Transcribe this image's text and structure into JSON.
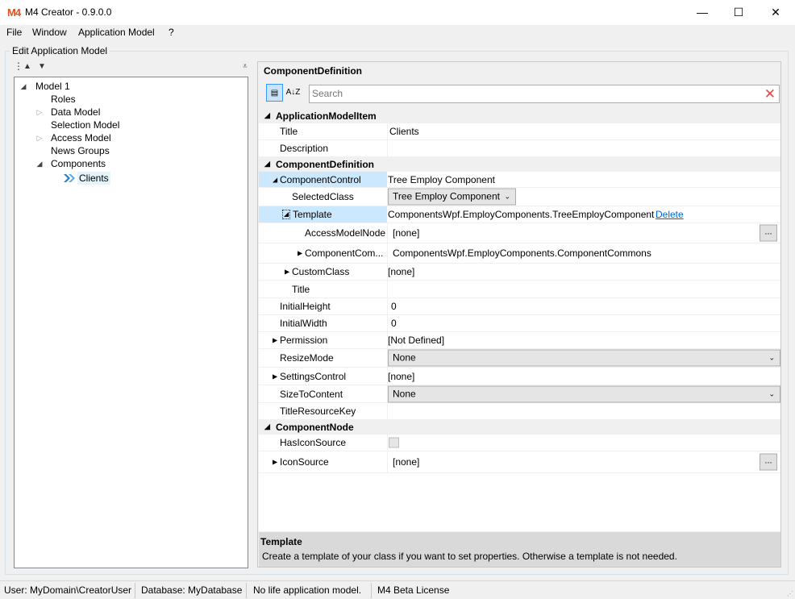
{
  "app": {
    "logo": "M4",
    "title": "M4 Creator - 0.9.0.0"
  },
  "window_controls": {
    "minimize": "—",
    "maximize": "☐",
    "close": "✕"
  },
  "menu": [
    "File",
    "Window",
    "Application Model",
    "?"
  ],
  "group": {
    "label": "Edit Application Model"
  },
  "tree_toolbar": {
    "grip": "⋮",
    "up": "▲",
    "down": "▼",
    "overflow": "⩡"
  },
  "tree": {
    "nodes": [
      {
        "label": "Model 1",
        "arrow": "◢"
      },
      {
        "label": "Roles",
        "arrow": ""
      },
      {
        "label": "Data Model",
        "arrow": "▷"
      },
      {
        "label": "Selection Model",
        "arrow": ""
      },
      {
        "label": "Access Model",
        "arrow": "▷"
      },
      {
        "label": "News Groups",
        "arrow": ""
      },
      {
        "label": "Components",
        "arrow": "◢"
      },
      {
        "label": "Clients",
        "arrow": ""
      }
    ]
  },
  "property_grid": {
    "header": "ComponentDefinition",
    "categorized_icon": "▤",
    "alphabetical_icon": "A↓Z",
    "search_placeholder": "Search",
    "clear_icon": "✕",
    "categories": [
      "ApplicationModelItem",
      "ComponentDefinition",
      "ComponentNode"
    ],
    "cat_arrow": "◢",
    "rows": {
      "title": {
        "name": "Title",
        "value": "Clients"
      },
      "description": {
        "name": "Description",
        "value": ""
      },
      "component_control": {
        "name": "ComponentControl",
        "value": "Tree Employ Component",
        "arrow": "◢"
      },
      "selected_class": {
        "name": "SelectedClass",
        "value": "Tree Employ Component",
        "chev": "⌄"
      },
      "template": {
        "name": "Template",
        "value": "ComponentsWpf.EmployComponents.TreeEmployComponent",
        "link": "Delete",
        "arrow": "◢"
      },
      "access_model_node": {
        "name": "AccessModelNode",
        "value": "[none]",
        "button": "..."
      },
      "component_commons": {
        "name": "ComponentCom...",
        "value": "ComponentsWpf.EmployComponents.ComponentCommons",
        "arrow": "▶"
      },
      "custom_class": {
        "name": "CustomClass",
        "value": "[none]",
        "arrow": "▶"
      },
      "inner_title": {
        "name": "Title",
        "value": ""
      },
      "initial_height": {
        "name": "InitialHeight",
        "value": "0"
      },
      "initial_width": {
        "name": "InitialWidth",
        "value": "0"
      },
      "permission": {
        "name": "Permission",
        "value": "[Not Defined]",
        "arrow": "▶"
      },
      "resize_mode": {
        "name": "ResizeMode",
        "value": "None",
        "chev": "⌄"
      },
      "settings_control": {
        "name": "SettingsControl",
        "value": "[none]",
        "arrow": "▶"
      },
      "size_to_content": {
        "name": "SizeToContent",
        "value": "None",
        "chev": "⌄"
      },
      "title_resource_key": {
        "name": "TitleResourceKey",
        "value": ""
      },
      "has_icon_source": {
        "name": "HasIconSource",
        "checked": false
      },
      "icon_source": {
        "name": "IconSource",
        "value": "[none]",
        "button": "...",
        "arrow": "▶"
      }
    },
    "description": {
      "title": "Template",
      "text": "Create a template of your class if you want to set properties. Otherwise a template is not needed."
    }
  },
  "status": {
    "user": "User: MyDomain\\CreatorUser",
    "database": "Database: MyDatabase",
    "model": "No life application model.",
    "license": "M4 Beta License",
    "grip": "⋰"
  }
}
